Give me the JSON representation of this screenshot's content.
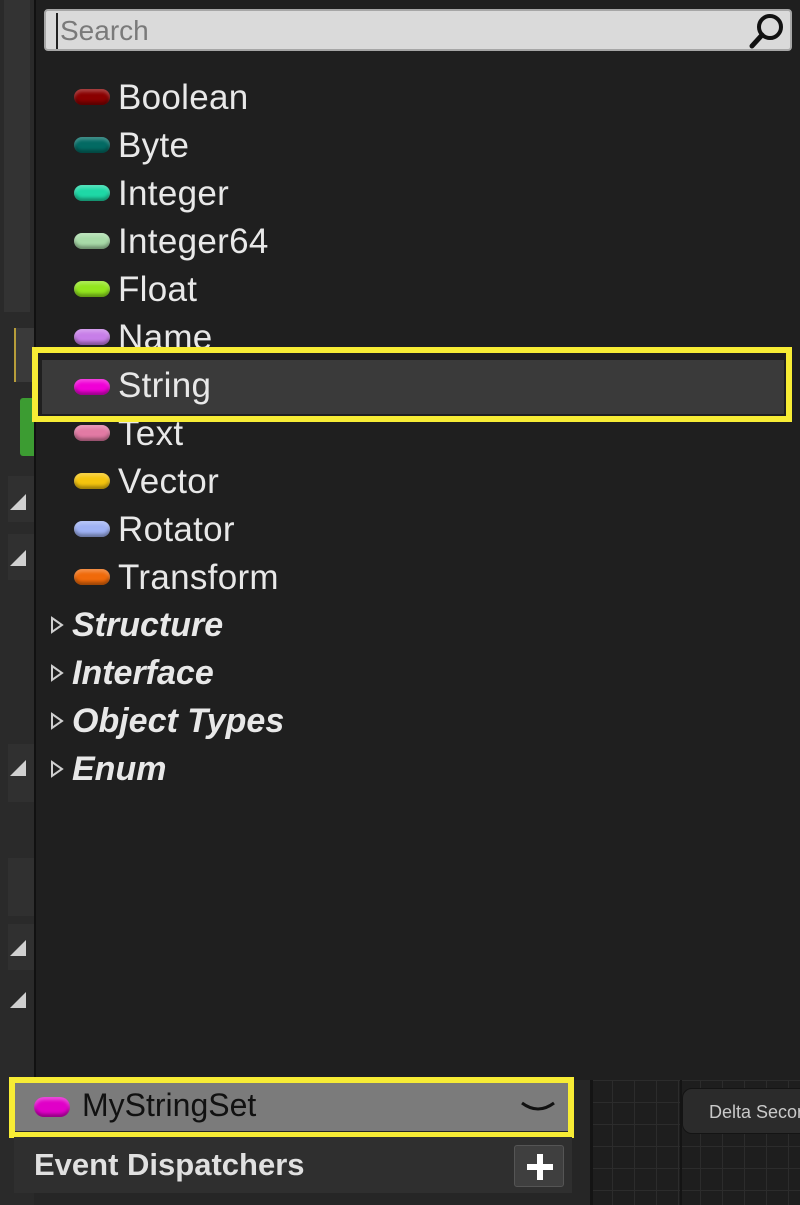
{
  "search": {
    "placeholder": "Search",
    "value": ""
  },
  "types": [
    {
      "label": "Boolean",
      "color": "#8a0000",
      "icon": "boolean-pin-icon"
    },
    {
      "label": "Byte",
      "color": "#036a63",
      "icon": "byte-pin-icon"
    },
    {
      "label": "Integer",
      "color": "#1ed8a6",
      "icon": "integer-pin-icon"
    },
    {
      "label": "Integer64",
      "color": "#a8dba8",
      "icon": "integer64-pin-icon"
    },
    {
      "label": "Float",
      "color": "#92e61e",
      "icon": "float-pin-icon"
    },
    {
      "label": "Name",
      "color": "#c77ee8",
      "icon": "name-pin-icon"
    },
    {
      "label": "String",
      "color": "#f000d6",
      "icon": "string-pin-icon",
      "selected": true
    },
    {
      "label": "Text",
      "color": "#e27aa4",
      "icon": "text-pin-icon"
    },
    {
      "label": "Vector",
      "color": "#f5c50e",
      "icon": "vector-pin-icon"
    },
    {
      "label": "Rotator",
      "color": "#9fb2f4",
      "icon": "rotator-pin-icon"
    },
    {
      "label": "Transform",
      "color": "#f06a0a",
      "icon": "transform-pin-icon"
    }
  ],
  "categories": [
    {
      "label": "Structure"
    },
    {
      "label": "Interface"
    },
    {
      "label": "Object Types"
    },
    {
      "label": "Enum"
    }
  ],
  "variable": {
    "name": "MyStringSet",
    "color": "#e000c8"
  },
  "event_dispatchers": {
    "title": "Event Dispatchers"
  },
  "graph": {
    "node_label": "Delta Seconds"
  },
  "highlight_color": "#f7ec35"
}
